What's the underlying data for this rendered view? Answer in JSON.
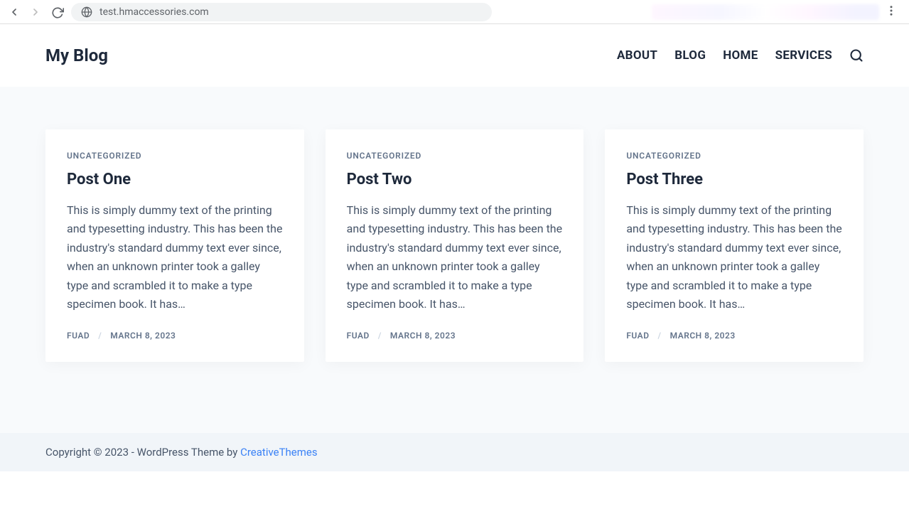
{
  "browser": {
    "url": "test.hmaccessories.com"
  },
  "header": {
    "site_title": "My Blog",
    "nav": [
      "ABOUT",
      "BLOG",
      "HOME",
      "SERVICES"
    ]
  },
  "posts": [
    {
      "category": "UNCATEGORIZED",
      "title": "Post One",
      "excerpt": "This is simply dummy text of the printing and typesetting industry. This has been the industry's standard dummy text ever since, when an unknown printer took a galley type and scrambled it to make a type specimen book. It has…",
      "author": "FUAD",
      "date": "MARCH 8, 2023"
    },
    {
      "category": "UNCATEGORIZED",
      "title": "Post Two",
      "excerpt": "This is simply dummy text of the printing and typesetting industry. This has been the industry's standard dummy text ever since, when an unknown printer took a galley type and scrambled it to make a type specimen book. It has…",
      "author": "FUAD",
      "date": "MARCH 8, 2023"
    },
    {
      "category": "UNCATEGORIZED",
      "title": "Post Three",
      "excerpt": "This is simply dummy text of the printing and typesetting industry. This has been the industry's standard dummy text ever since, when an unknown printer took a galley type and scrambled it to make a type specimen book. It has…",
      "author": "FUAD",
      "date": "MARCH 8, 2023"
    }
  ],
  "footer": {
    "copyright": "Copyright © 2023 - WordPress Theme by ",
    "link_text": "CreativeThemes"
  }
}
